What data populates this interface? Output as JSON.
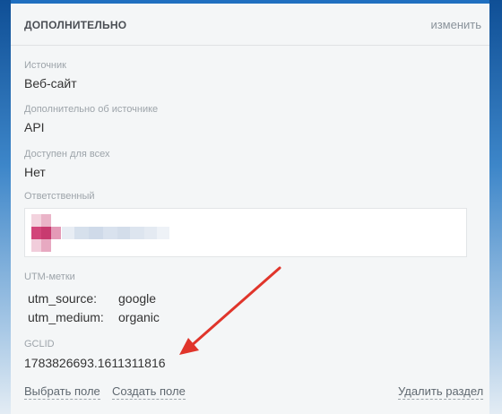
{
  "section": {
    "title": "ДОПОЛНИТЕЛЬНО",
    "edit_label": "изменить"
  },
  "fields": {
    "source": {
      "label": "Источник",
      "value": "Веб-сайт"
    },
    "source_extra": {
      "label": "Дополнительно об источнике",
      "value": "API"
    },
    "public": {
      "label": "Доступен для всех",
      "value": "Нет"
    },
    "responsible": {
      "label": "Ответственный"
    },
    "utm": {
      "label": "UTM-метки",
      "rows": [
        {
          "key": "utm_source:",
          "value": "google"
        },
        {
          "key": "utm_medium:",
          "value": "organic"
        }
      ]
    },
    "gclid": {
      "label": "GCLID",
      "value": "1783826693.1611311816"
    }
  },
  "footer": {
    "choose_field": "Выбрать поле",
    "create_field": "Создать поле",
    "delete_section": "Удалить раздел"
  },
  "colors": {
    "arrow": "#e0352b",
    "avatar_pink": "#d2457a",
    "card_bg": "#f4f6f7"
  }
}
